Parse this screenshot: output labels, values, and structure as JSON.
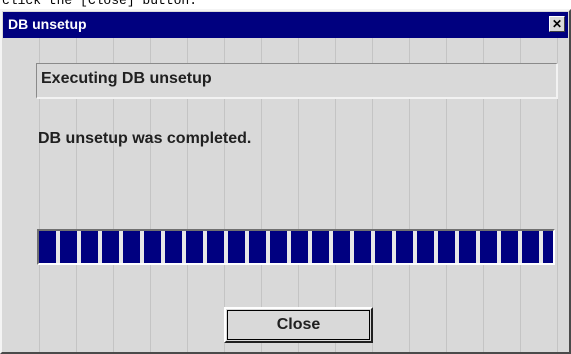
{
  "page_caption": "click the [Close] button.",
  "window": {
    "title": "DB unsetup",
    "close_glyph": "✕"
  },
  "status_panel": {
    "text": "Executing DB unsetup"
  },
  "message": "DB unsetup was completed.",
  "progress": {
    "percent": 100,
    "fill_color": "#000080"
  },
  "buttons": {
    "close_label": "Close"
  },
  "colors": {
    "title_bar": "#00007f",
    "window_face": "#d9d9d9"
  }
}
